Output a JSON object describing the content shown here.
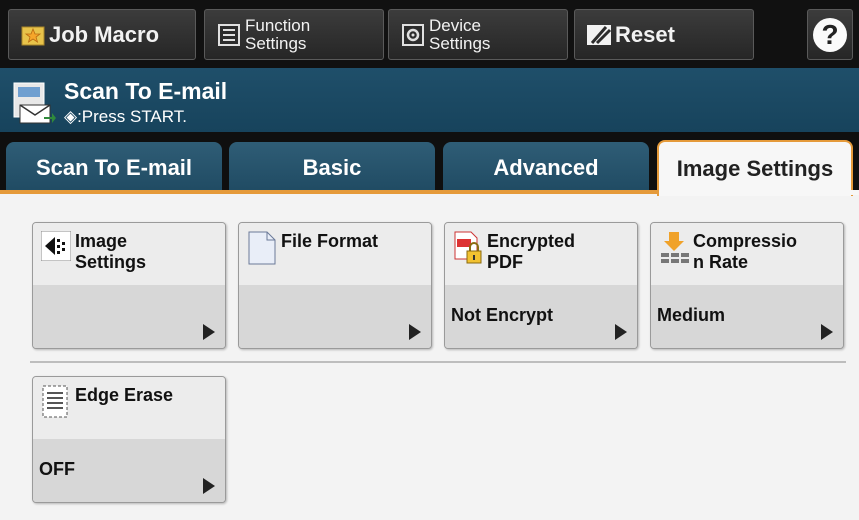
{
  "toolbar": {
    "job_macro": "Job Macro",
    "function_settings_line1": "Function",
    "function_settings_line2": "Settings",
    "device_settings_line1": "Device",
    "device_settings_line2": "Settings",
    "reset": "Reset",
    "help": "?"
  },
  "header": {
    "title": "Scan To E-mail",
    "subtitle": "◈:Press START."
  },
  "tabs": [
    {
      "label": "Scan To E-mail"
    },
    {
      "label": "Basic"
    },
    {
      "label": "Advanced"
    },
    {
      "label": "Image Settings"
    }
  ],
  "tiles": [
    {
      "label_line1": "Image",
      "label_line2": "Settings",
      "value": "",
      "icon": "image-settings-icon"
    },
    {
      "label_line1": "File Format",
      "label_line2": "",
      "value": "",
      "icon": "file-format-icon"
    },
    {
      "label_line1": "Encrypted",
      "label_line2": "PDF",
      "value": "Not Encrypt",
      "icon": "encrypted-pdf-icon"
    },
    {
      "label_line1": "Compressio",
      "label_line2": "n Rate",
      "value": "Medium",
      "icon": "compression-rate-icon"
    },
    {
      "label_line1": "Edge Erase",
      "label_line2": "",
      "value": "OFF",
      "icon": "edge-erase-icon"
    }
  ],
  "colors": {
    "header_bg": "#1f4f6a",
    "tab_accent": "#e59a3a",
    "toolbar_bg": "#111111"
  }
}
